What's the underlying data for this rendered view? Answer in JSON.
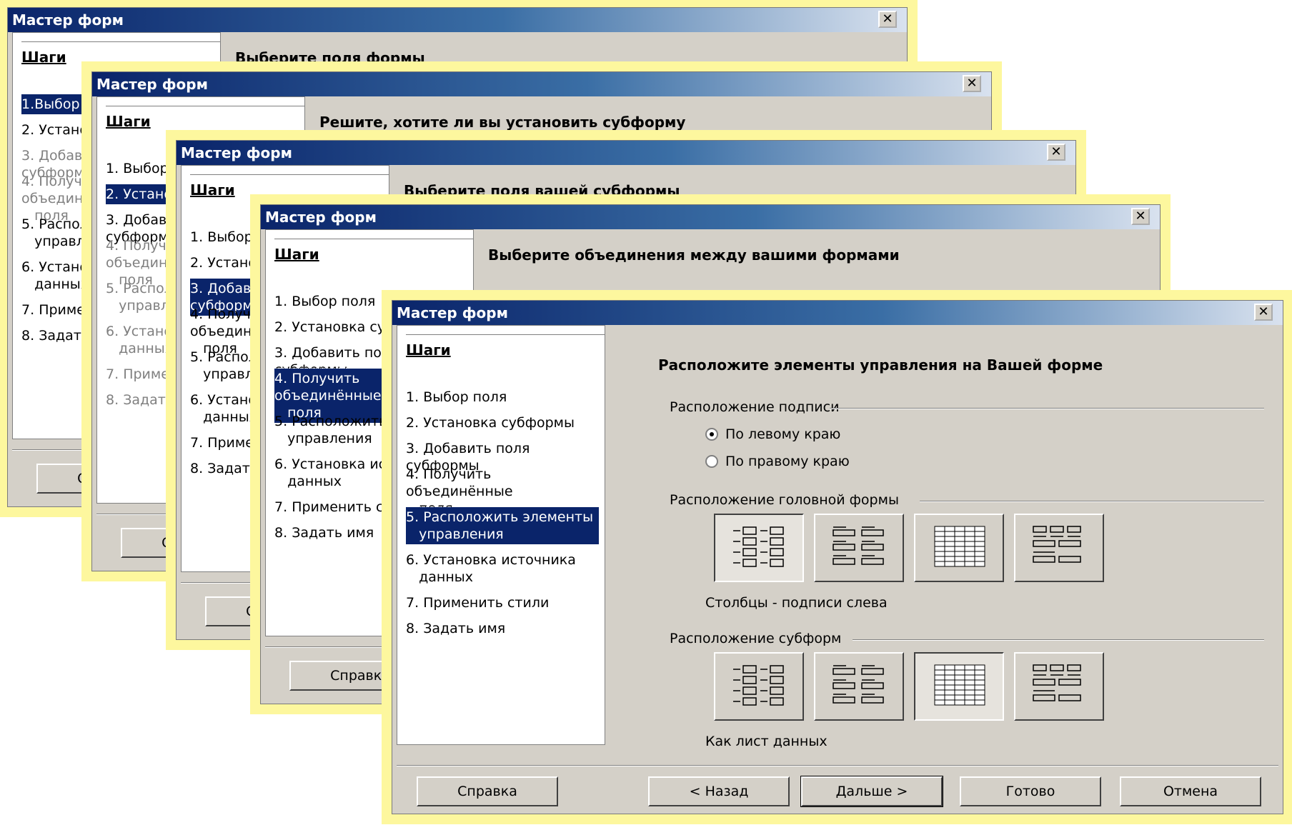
{
  "window_title": "Мастер форм",
  "close_glyph": "✕",
  "steps_header": "Шаги",
  "steps": [
    {
      "num": "1.",
      "label": "Выбор поля"
    },
    {
      "num": "2.",
      "label": "Установка субформы"
    },
    {
      "num": "3.",
      "label": "Добавить поля субформы"
    },
    {
      "num": "4.",
      "label": "Получить объединённые",
      "label2": "поля"
    },
    {
      "num": "5.",
      "label": "Расположить элементы",
      "label2": "управления"
    },
    {
      "num": "6.",
      "label": "Установка источника",
      "label2": "данных"
    },
    {
      "num": "7.",
      "label": "Применить стили"
    },
    {
      "num": "8.",
      "label": "Задать имя"
    }
  ],
  "back_windows": [
    {
      "heading": "Выберите поля формы",
      "selected_step": 1
    },
    {
      "heading": "Решите, хотите ли вы установить субформу",
      "selected_step": 2
    },
    {
      "heading": "Выберите поля вашей субформы",
      "selected_step": 3
    },
    {
      "heading": "Выберите объединения между вашими формами",
      "selected_step": 4
    }
  ],
  "front": {
    "heading": "Расположите элементы управления на Вашей форме",
    "selected_step": 5,
    "label_group": {
      "title": "Расположение подписи",
      "options": [
        "По левому краю",
        "По правому краю"
      ],
      "selected": 0
    },
    "main_form_group": {
      "title": "Расположение головной формы",
      "layout_icons": [
        "columns-labels-left-icon",
        "columns-labels-top-icon",
        "datasheet-icon",
        "blocks-labels-above-icon"
      ],
      "selected": 0,
      "caption": "Столбцы - подписи слева"
    },
    "subform_group": {
      "title": "Расположение субформ",
      "layout_icons": [
        "columns-labels-left-icon",
        "columns-labels-top-icon",
        "datasheet-icon",
        "blocks-labels-above-icon"
      ],
      "selected": 2,
      "caption": "Как лист данных"
    }
  },
  "buttons": {
    "help": "Справка",
    "help_short": "Сп",
    "back": "< Назад",
    "next": "Дальше >",
    "finish": "Готово",
    "cancel": "Отмена"
  }
}
